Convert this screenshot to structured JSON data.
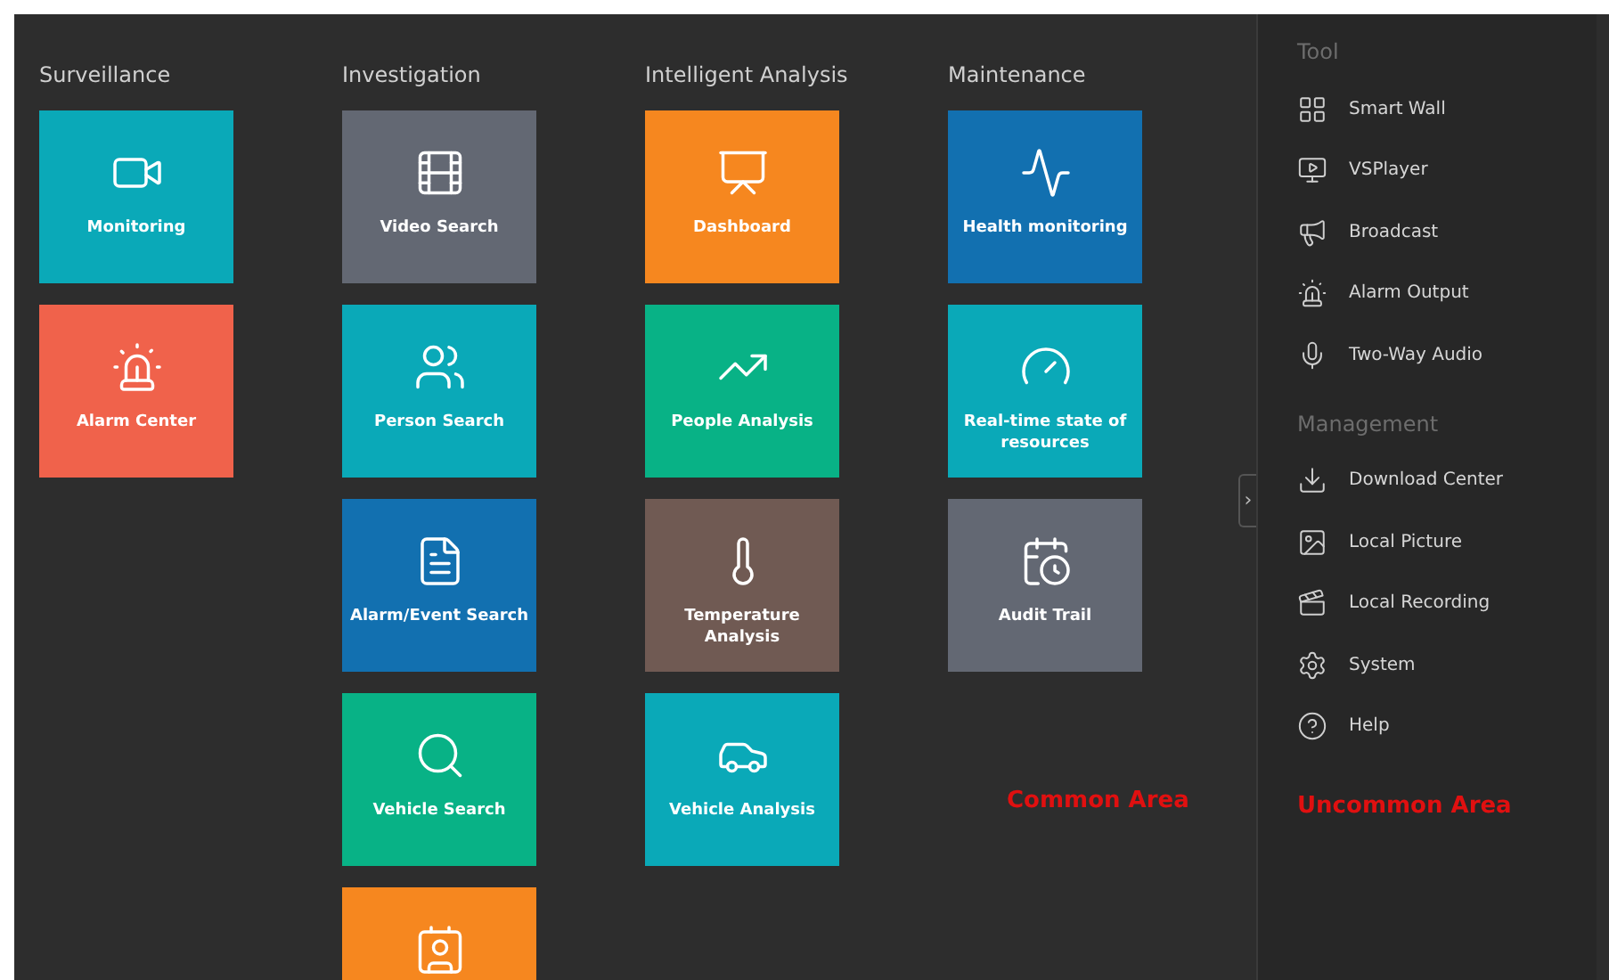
{
  "columns": [
    {
      "title": "Surveillance",
      "tiles": [
        {
          "label": "Monitoring",
          "color": "#0aa9b8"
        },
        {
          "label": "Alarm Center",
          "color": "#f0624b"
        }
      ]
    },
    {
      "title": "Investigation",
      "tiles": [
        {
          "label": "Video Search",
          "color": "#636873"
        },
        {
          "label": "Person Search",
          "color": "#0aa9b8"
        },
        {
          "label": "Alarm/Event Search",
          "color": "#1270b0"
        },
        {
          "label": "Vehicle Search",
          "color": "#08b286"
        },
        {
          "color": "#f6871f"
        }
      ]
    },
    {
      "title": "Intelligent Analysis",
      "tiles": [
        {
          "label": "Dashboard",
          "color": "#f6871f"
        },
        {
          "label": "People Analysis",
          "color": "#08b286"
        },
        {
          "label": "Temperature Analysis",
          "color": "#705a53"
        },
        {
          "label": "Vehicle Analysis",
          "color": "#0aa9b8"
        }
      ]
    },
    {
      "title": "Maintenance",
      "tiles": [
        {
          "label": "Health monitoring",
          "color": "#1270b0"
        },
        {
          "label": "Real-time state of resources",
          "color": "#0aa9b8"
        },
        {
          "label": "Audit Trail",
          "color": "#636873"
        }
      ]
    }
  ],
  "annotation_common": "Common Area",
  "sidebar": {
    "toggle": "›",
    "sections": [
      {
        "title": "Tool",
        "items": [
          {
            "label": "Smart Wall"
          },
          {
            "label": "VSPlayer"
          },
          {
            "label": "Broadcast"
          },
          {
            "label": "Alarm Output"
          },
          {
            "label": "Two-Way Audio"
          }
        ]
      },
      {
        "title": "Management",
        "items": [
          {
            "label": "Download Center"
          },
          {
            "label": "Local Picture"
          },
          {
            "label": "Local Recording"
          },
          {
            "label": "System"
          },
          {
            "label": "Help"
          }
        ]
      }
    ],
    "annotation": "Uncommon Area"
  }
}
